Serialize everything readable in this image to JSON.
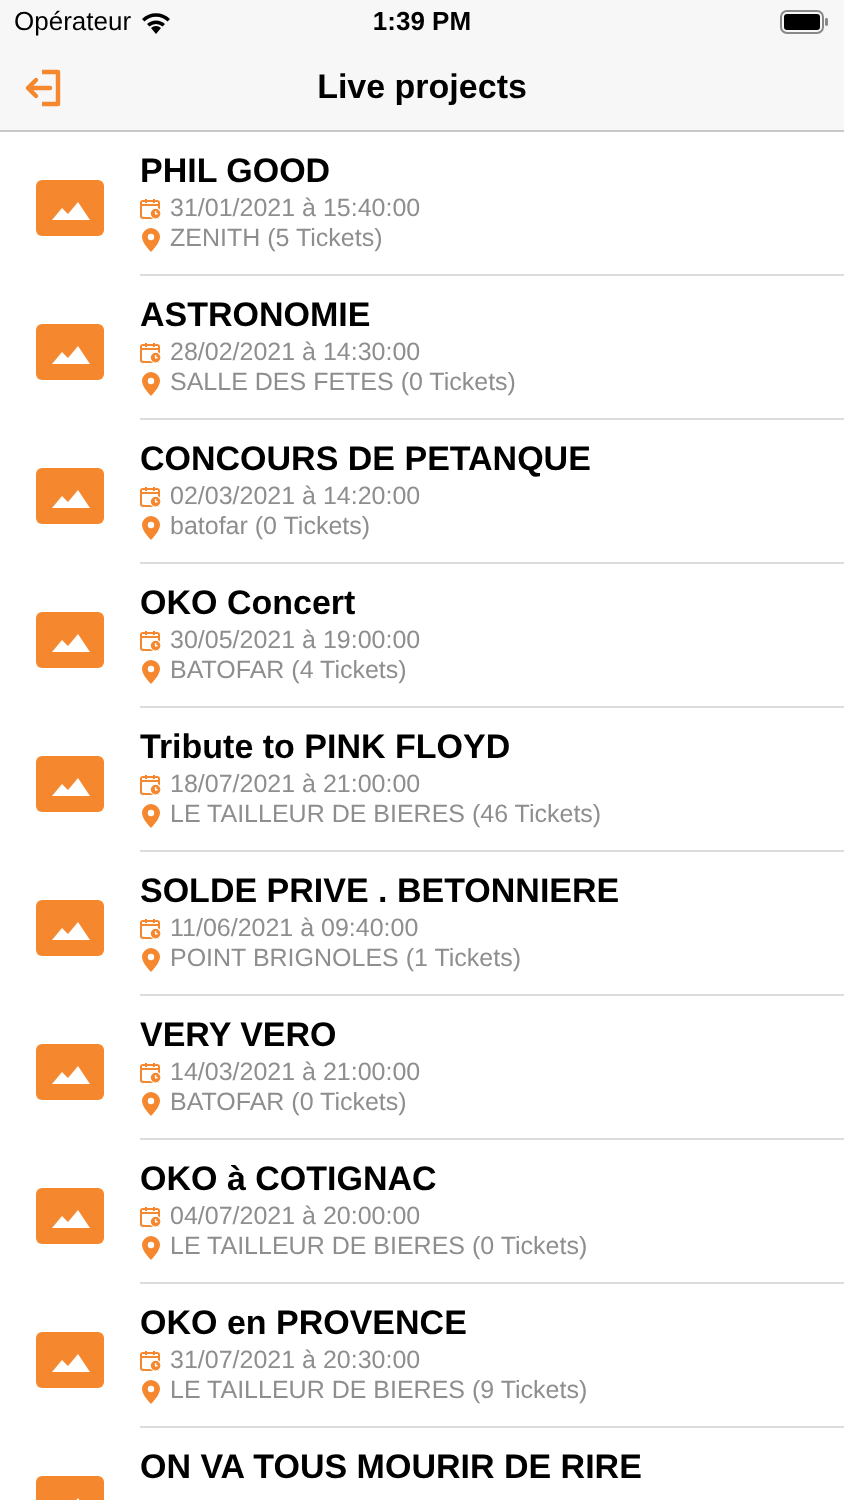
{
  "status_bar": {
    "carrier": "Opérateur",
    "time": "1:39 PM"
  },
  "nav_bar": {
    "title": "Live projects"
  },
  "projects": [
    {
      "title": "PHIL GOOD",
      "date": "31/01/2021 à 15:40:00",
      "venue": "ZENITH (5 Tickets)"
    },
    {
      "title": "ASTRONOMIE",
      "date": "28/02/2021 à 14:30:00",
      "venue": "SALLE DES FETES (0 Tickets)"
    },
    {
      "title": "CONCOURS DE PETANQUE",
      "date": "02/03/2021 à 14:20:00",
      "venue": "batofar (0 Tickets)"
    },
    {
      "title": "OKO Concert",
      "date": "30/05/2021 à 19:00:00",
      "venue": "BATOFAR (4 Tickets)"
    },
    {
      "title": "Tribute to PINK FLOYD",
      "date": "18/07/2021 à 21:00:00",
      "venue": "LE TAILLEUR DE BIERES (46 Tickets)"
    },
    {
      "title": "SOLDE PRIVE . BETONNIERE",
      "date": "11/06/2021 à 09:40:00",
      "venue": "POINT BRIGNOLES (1 Tickets)"
    },
    {
      "title": "VERY VERO",
      "date": "14/03/2021 à 21:00:00",
      "venue": "BATOFAR (0 Tickets)"
    },
    {
      "title": "OKO à COTIGNAC",
      "date": "04/07/2021 à 20:00:00",
      "venue": "LE TAILLEUR DE BIERES (0 Tickets)"
    },
    {
      "title": "OKO en PROVENCE",
      "date": "31/07/2021 à 20:30:00",
      "venue": "LE TAILLEUR DE BIERES (9 Tickets)"
    },
    {
      "title": "ON VA TOUS MOURIR DE RIRE"
    }
  ]
}
